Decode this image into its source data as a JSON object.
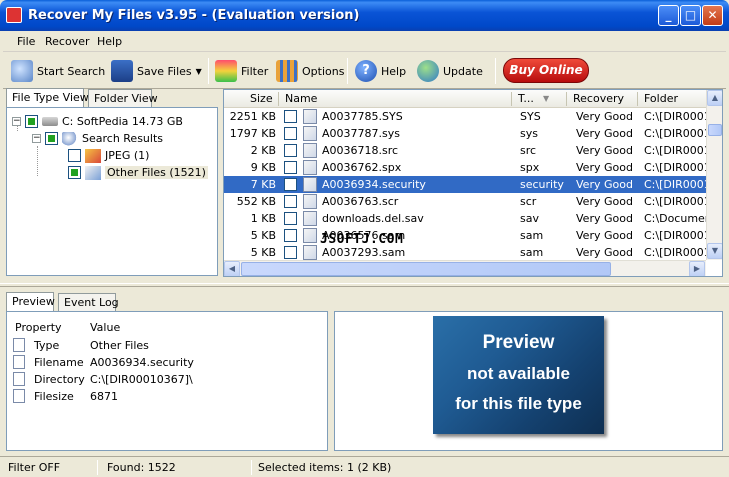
{
  "window": {
    "title": "Recover My Files v3.95  -  (Evaluation version)",
    "minimize": "_",
    "maximize": "□",
    "close": "✕"
  },
  "menu": [
    "File",
    "Recover",
    "Help"
  ],
  "toolbar": {
    "start_search": "Start Search",
    "save_files": "Save Files",
    "filter": "Filter",
    "options": "Options",
    "help": "Help",
    "update": "Update",
    "buy_online": "Buy Online"
  },
  "left_tabs": [
    "File Type View",
    "Folder View"
  ],
  "tree": {
    "drive": "C: SoftPedia  14.73 GB",
    "search_results": "Search Results",
    "jpeg": "JPEG (1)",
    "other": "Other Files (1521)"
  },
  "file_list": {
    "columns": [
      "Size",
      "Name",
      "T...",
      "Recovery",
      "Folder"
    ],
    "rows": [
      {
        "size": "2251 KB",
        "name": "A0037785.SYS",
        "type": "SYS",
        "recovery": "Very Good",
        "folder": "C:\\[DIR0001"
      },
      {
        "size": "1797 KB",
        "name": "A0037787.sys",
        "type": "sys",
        "recovery": "Very Good",
        "folder": "C:\\[DIR0001"
      },
      {
        "size": "2 KB",
        "name": "A0036718.src",
        "type": "src",
        "recovery": "Very Good",
        "folder": "C:\\[DIR0001"
      },
      {
        "size": "9 KB",
        "name": "A0036762.spx",
        "type": "spx",
        "recovery": "Very Good",
        "folder": "C:\\[DIR0001"
      },
      {
        "size": "7 KB",
        "name": "A0036934.security",
        "type": "security",
        "recovery": "Very Good",
        "folder": "C:\\[DIR0001"
      },
      {
        "size": "552 KB",
        "name": "A0036763.scr",
        "type": "scr",
        "recovery": "Very Good",
        "folder": "C:\\[DIR0001"
      },
      {
        "size": "1 KB",
        "name": "downloads.del.sav",
        "type": "sav",
        "recovery": "Very Good",
        "folder": "C:\\Documen"
      },
      {
        "size": "5 KB",
        "name": "A0036576.sam",
        "type": "sam",
        "recovery": "Very Good",
        "folder": "C:\\[DIR0001"
      },
      {
        "size": "5 KB",
        "name": "A0037293.sam",
        "type": "sam",
        "recovery": "Very Good",
        "folder": "C:\\[DIR0001"
      }
    ],
    "selected_index": 4
  },
  "bottom_tabs": [
    "Preview",
    "Event Log"
  ],
  "properties": {
    "header": [
      "Property",
      "Value"
    ],
    "rows": [
      {
        "property": "Type",
        "value": "Other Files"
      },
      {
        "property": "Filename",
        "value": "A0036934.security"
      },
      {
        "property": "Directory",
        "value": "C:\\[DIR00010367]\\"
      },
      {
        "property": "Filesize",
        "value": "6871"
      }
    ]
  },
  "preview": {
    "line1": "Preview",
    "line2": "not available",
    "line3": "for this file type"
  },
  "watermark": "JSOFTJ.COM",
  "status": {
    "filter": "Filter OFF",
    "found": "Found: 1522",
    "selected": "Selected items: 1 (2 KB)"
  }
}
